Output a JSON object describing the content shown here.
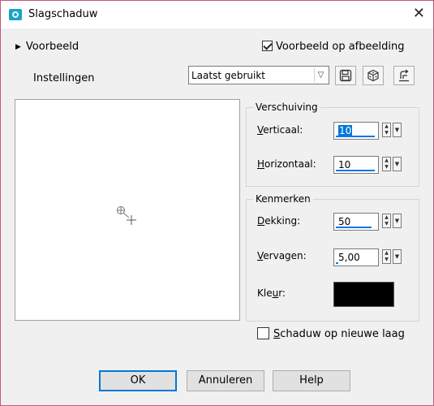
{
  "window": {
    "title": "Slagschaduw",
    "close_glyph": "✕",
    "border_color": "#c0587a"
  },
  "preview": {
    "expander_label": "Voorbeeld",
    "on_image_label": "Voorbeeld op afbeelding",
    "on_image_checked": true
  },
  "settings": {
    "label": "Instellingen",
    "preset_value": "Laatst gebruikt",
    "icons": [
      "save-preset-icon",
      "random-icon",
      "reset-icon"
    ]
  },
  "offset": {
    "title": "Verschuiving",
    "vertical": {
      "label_pre": "",
      "label_ul": "V",
      "label_post": "erticaal:",
      "value": "10",
      "level": 0.1
    },
    "horizontal": {
      "label_pre": "",
      "label_ul": "H",
      "label_post": "orizontaal:",
      "value": "10",
      "level": 0.1
    }
  },
  "properties": {
    "title": "Kenmerken",
    "opacity": {
      "label_pre": "",
      "label_ul": "D",
      "label_post": "ekking:",
      "value": "50",
      "level": 0.5
    },
    "blur": {
      "label_pre": "",
      "label_ul": "V",
      "label_post": "ervagen:",
      "value": "5,00",
      "level": 0.05
    },
    "color": {
      "label_pre": "Kle",
      "label_ul": "u",
      "label_post": "r:",
      "value_hex": "#000000"
    }
  },
  "new_layer": {
    "label_pre": "",
    "label_ul": "S",
    "label_post": "chaduw op nieuwe laag",
    "checked": false
  },
  "buttons": {
    "ok": "OK",
    "cancel": "Annuleren",
    "help": "Help"
  }
}
